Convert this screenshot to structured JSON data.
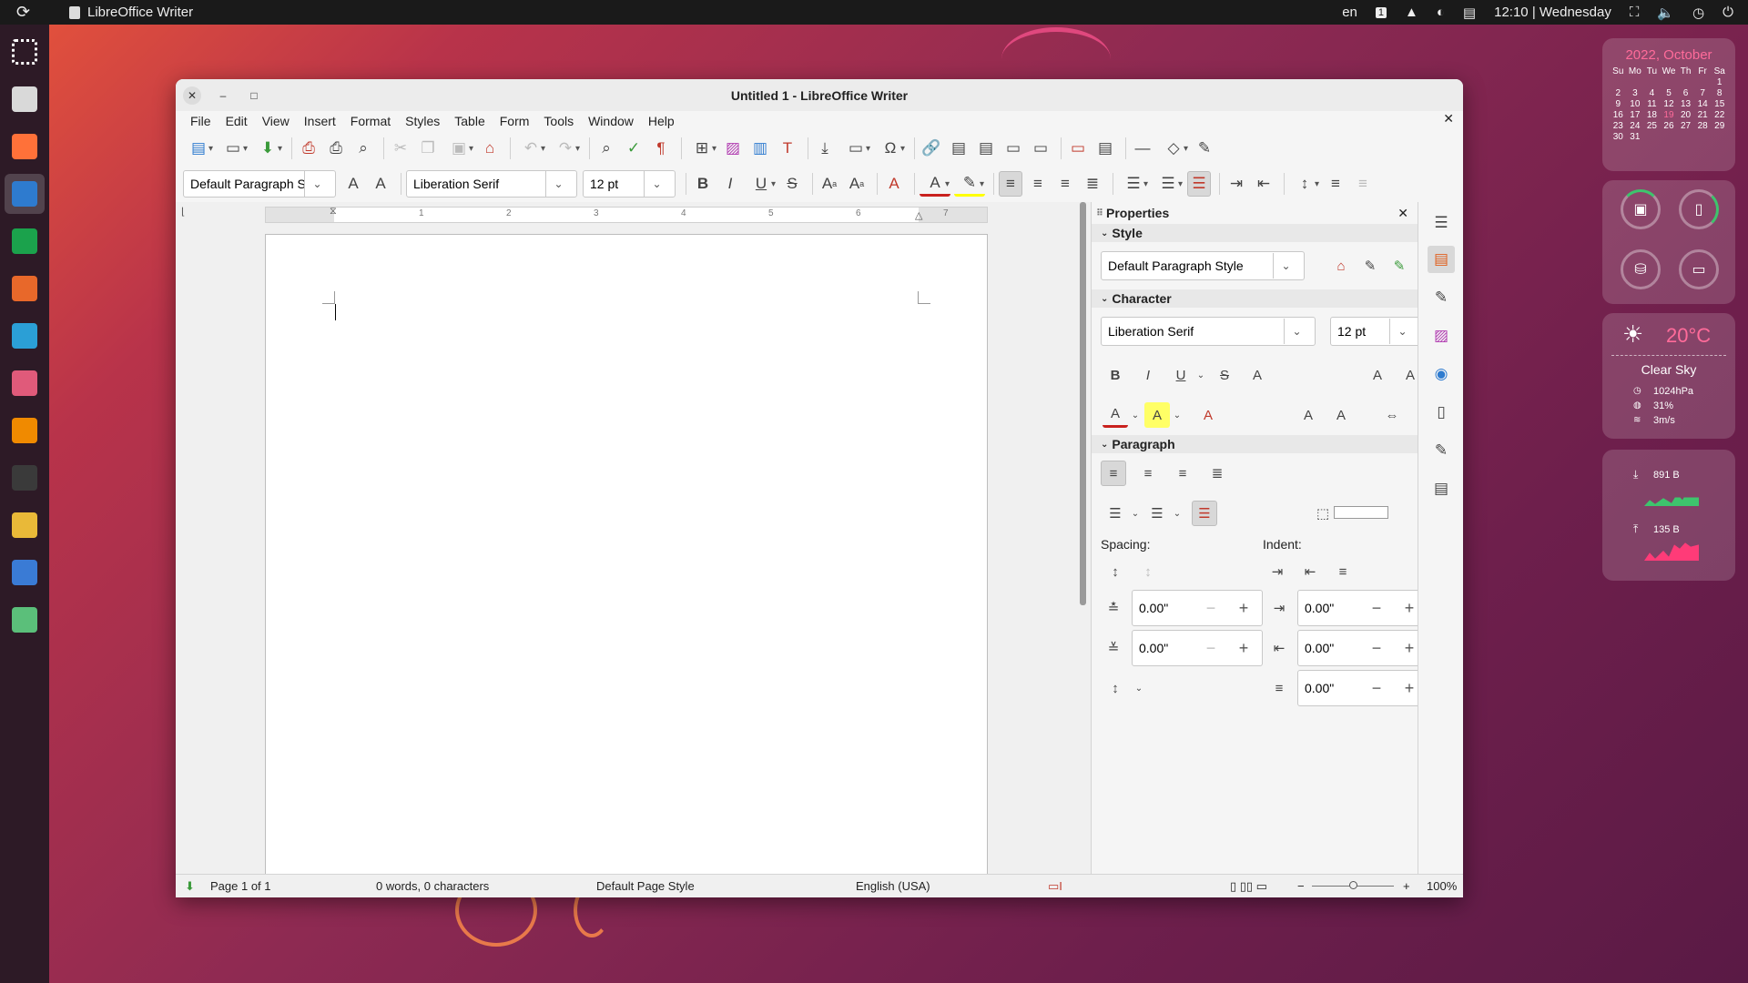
{
  "topbar": {
    "app_name": "LibreOffice Writer",
    "language": "en",
    "workspace": "1",
    "clock": "12:10 | Wednesday"
  },
  "dock": {
    "items": [
      {
        "name": "app-grid",
        "color": "#ffffff"
      },
      {
        "name": "files",
        "color": "#d9d9d9"
      },
      {
        "name": "firefox",
        "color": "#ff7139"
      },
      {
        "name": "writer",
        "color": "#2e7bcf"
      },
      {
        "name": "calc",
        "color": "#1ba24c"
      },
      {
        "name": "impress",
        "color": "#e8682a"
      },
      {
        "name": "software",
        "color": "#2b9fd6"
      },
      {
        "name": "downloader",
        "color": "#e05a7a"
      },
      {
        "name": "vlc",
        "color": "#f08a00"
      },
      {
        "name": "terminal",
        "color": "#3a3a3a"
      },
      {
        "name": "text-editor",
        "color": "#e9b938"
      },
      {
        "name": "screenshot",
        "color": "#3a7bd5"
      },
      {
        "name": "trash",
        "color": "#5bbf7a"
      }
    ]
  },
  "window": {
    "title": "Untitled 1 - LibreOffice Writer",
    "menu": [
      "File",
      "Edit",
      "View",
      "Insert",
      "Format",
      "Styles",
      "Table",
      "Form",
      "Tools",
      "Window",
      "Help"
    ]
  },
  "toolbar": {
    "paragraph_style": "Default Paragraph S",
    "font_name": "Liberation Serif",
    "font_size": "12 pt"
  },
  "ruler": {
    "numbers": [
      "1",
      "2",
      "3",
      "4",
      "5",
      "6",
      "7"
    ]
  },
  "sidebar": {
    "title": "Properties",
    "style_section": "Style",
    "style_value": "Default Paragraph Style",
    "character_section": "Character",
    "char_font": "Liberation Serif",
    "char_size": "12 pt",
    "paragraph_section": "Paragraph",
    "spacing_label": "Spacing:",
    "indent_label": "Indent:",
    "spacing_above": "0.00\"",
    "spacing_below": "0.00\"",
    "indent_before": "0.00\"",
    "indent_after": "0.00\"",
    "indent_first": "0.00\""
  },
  "status": {
    "page": "Page 1 of 1",
    "words": "0 words, 0 characters",
    "page_style": "Default Page Style",
    "language": "English (USA)",
    "zoom": "100%"
  },
  "calendar": {
    "title": "2022, October",
    "weekdays": [
      "Su",
      "Mo",
      "Tu",
      "We",
      "Th",
      "Fr",
      "Sa"
    ],
    "days": [
      "",
      "",
      "",
      "",
      "",
      "",
      "1",
      "2",
      "3",
      "4",
      "5",
      "6",
      "7",
      "8",
      "9",
      "10",
      "11",
      "12",
      "13",
      "14",
      "15",
      "16",
      "17",
      "18",
      "19",
      "20",
      "21",
      "22",
      "23",
      "24",
      "25",
      "26",
      "27",
      "28",
      "29",
      "30",
      "31"
    ],
    "today": "19"
  },
  "weather": {
    "temperature": "20°C",
    "condition": "Clear Sky",
    "pressure": "1024hPa",
    "humidity": "31%",
    "wind": "3m/s"
  },
  "network": {
    "download": "891 B",
    "upload": "135 B"
  }
}
